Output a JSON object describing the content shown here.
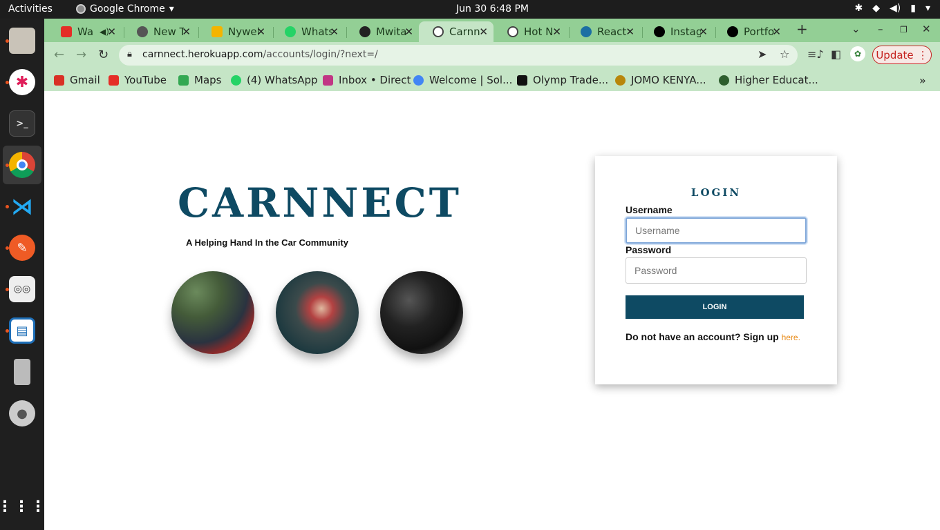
{
  "topbar": {
    "activities": "Activities",
    "app_name": "Google Chrome",
    "clock": "Jun 30   6:48 PM"
  },
  "dock": {
    "items": [
      "files",
      "slack",
      "terminal",
      "chrome",
      "vscode",
      "postman",
      "document-viewer",
      "libreoffice-impress",
      "device",
      "disc",
      "app-grid"
    ]
  },
  "tabs": [
    {
      "label": "Wa",
      "icon": "youtube-icon",
      "color": "#e52d27"
    },
    {
      "label": "New T",
      "icon": "chrome-icon",
      "color": "#555555"
    },
    {
      "label": "Nywel",
      "icon": "slides-icon",
      "color": "#f4b400"
    },
    {
      "label": "Whats",
      "icon": "whatsapp-icon",
      "color": "#25d366"
    },
    {
      "label": "Mwita",
      "icon": "github-icon",
      "color": "#222222"
    },
    {
      "label": "Carnn",
      "icon": "globe-icon",
      "color": "#444444",
      "active": true
    },
    {
      "label": "Hot N",
      "icon": "globe-icon",
      "color": "#444444"
    },
    {
      "label": "React",
      "icon": "react-icon",
      "color": "#1c6fa3"
    },
    {
      "label": "Instag",
      "icon": "vercel-icon",
      "color": "#000000"
    },
    {
      "label": "Portfo",
      "icon": "vercel-icon",
      "color": "#000000"
    }
  ],
  "omnibox": {
    "host": "carnnect.herokuapp.com",
    "path": "/accounts/login/?next=/"
  },
  "update_label": "Update",
  "bookmarks": [
    {
      "label": "Gmail",
      "color": "#d93025"
    },
    {
      "label": "YouTube",
      "color": "#e52d27"
    },
    {
      "label": "Maps",
      "color": "#34a853"
    },
    {
      "label": "(4) WhatsApp",
      "color": "#25d366"
    },
    {
      "label": "Inbox • Direct",
      "color": "#c13584"
    },
    {
      "label": "Welcome | Sol...",
      "color": "#4285f4"
    },
    {
      "label": "Olymp Trade...",
      "color": "#111111"
    },
    {
      "label": "JOMO KENYA...",
      "color": "#b8860b"
    },
    {
      "label": "Higher Educat...",
      "color": "#2e5e2e"
    }
  ],
  "page": {
    "brand": "CARNNECT",
    "tagline": "A Helping Hand In the Car Community",
    "login": {
      "title": "LOGIN",
      "username_label": "Username",
      "username_placeholder": "Username",
      "password_label": "Password",
      "password_placeholder": "Password",
      "button_label": "LOGIN",
      "signup_text": "Do not have an account? Sign up ",
      "signup_link": "here."
    }
  }
}
